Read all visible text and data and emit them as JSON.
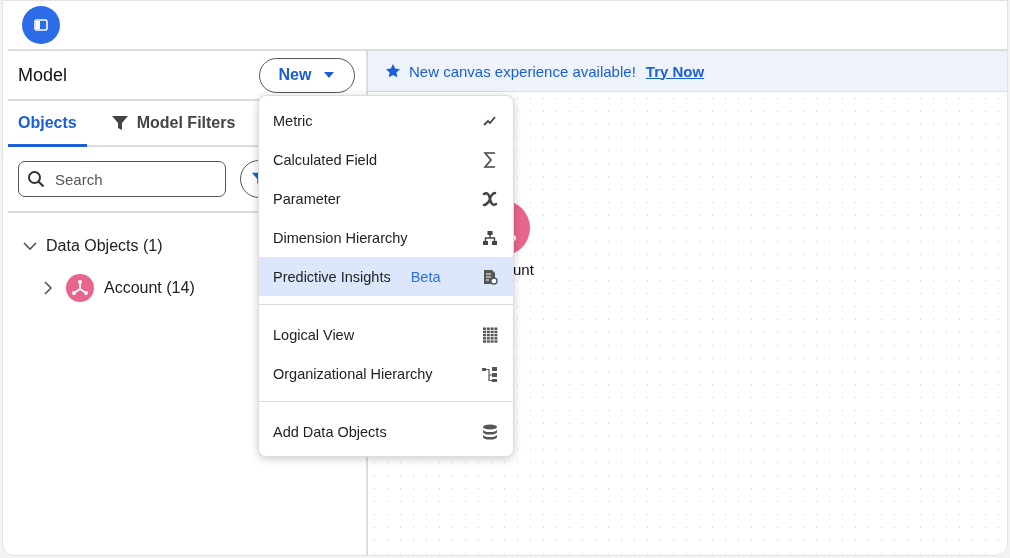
{
  "panel": {
    "title": "Model",
    "new_button": "New"
  },
  "tabs": [
    {
      "label": "Objects",
      "selected": true
    },
    {
      "label": "Model Filters",
      "selected": false
    }
  ],
  "search": {
    "placeholder": "Search"
  },
  "tree": [
    {
      "label": "Data Objects (1)",
      "expanded": true,
      "children": [
        {
          "label": "Account (14)",
          "expanded": false
        }
      ]
    }
  ],
  "banner": {
    "text": "New canvas experience available!",
    "link": "Try Now"
  },
  "canvas": {
    "node_label": "unt"
  },
  "menu": {
    "groups": [
      [
        {
          "label": "Metric",
          "selected": false
        },
        {
          "label": "Calculated Field",
          "selected": false
        },
        {
          "label": "Parameter",
          "selected": false
        },
        {
          "label": "Dimension Hierarchy",
          "selected": false
        },
        {
          "label": "Predictive Insights",
          "badge": "Beta",
          "selected": true
        }
      ],
      [
        {
          "label": "Logical View",
          "selected": false
        },
        {
          "label": "Organizational Hierarchy",
          "selected": false
        }
      ],
      [
        {
          "label": "Add Data Objects",
          "selected": false
        }
      ]
    ]
  }
}
